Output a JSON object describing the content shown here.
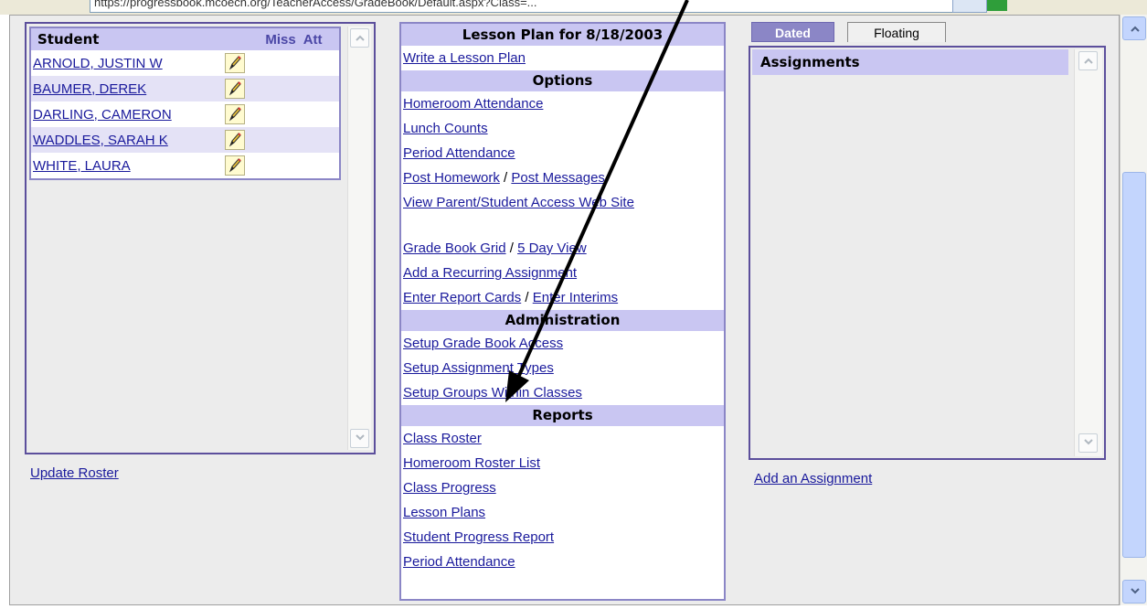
{
  "address_bar": {
    "url": "https://progressbook.mcoecn.org/TeacherAccess/GradeBook/Default.aspx?Class=..."
  },
  "students": {
    "header": {
      "student": "Student",
      "miss": "Miss",
      "att": "Att"
    },
    "rows": [
      {
        "name": "ARNOLD, JUSTIN W"
      },
      {
        "name": "BAUMER, DEREK"
      },
      {
        "name": "DARLING, CAMERON"
      },
      {
        "name": "WADDLES, SARAH K"
      },
      {
        "name": "WHITE, LAURA"
      }
    ],
    "update_roster": "Update Roster"
  },
  "lesson": {
    "title": "Lesson Plan for 8/18/2003",
    "write": "Write a Lesson Plan",
    "options_header": "Options",
    "homeroom_attendance": "Homeroom Attendance",
    "lunch_counts": "Lunch Counts",
    "period_attendance": "Period Attendance",
    "post_homework": "Post Homework",
    "post_messages": "Post Messages",
    "view_parent": "View Parent/Student Access Web Site",
    "grade_book_grid": "Grade Book Grid",
    "five_day_view": "5 Day View",
    "recurring": "Add a Recurring Assignment",
    "report_cards": "Enter Report Cards",
    "interims": "Enter Interims",
    "separator": " / ",
    "admin_header": "Administration",
    "setup_access": "Setup Grade Book Access",
    "setup_types": "Setup Assignment Types",
    "setup_groups": "Setup Groups Within Classes",
    "reports_header": "Reports",
    "class_roster": "Class Roster",
    "homeroom_roster": "Homeroom Roster List",
    "class_progress": "Class Progress",
    "lesson_plans": "Lesson Plans",
    "student_progress": "Student Progress Report",
    "period_attendance_report": "Period Attendance"
  },
  "assignments": {
    "tab_dated": "Dated",
    "tab_floating": "Floating",
    "header": "Assignments",
    "add": "Add an Assignment"
  },
  "icons": {
    "edit": "pencil-icon",
    "arrow": "annotation-arrow"
  },
  "colors": {
    "header_bg": "#c9c6f2",
    "panel_border": "#5c4f9c",
    "link": "#1a1a9c"
  }
}
